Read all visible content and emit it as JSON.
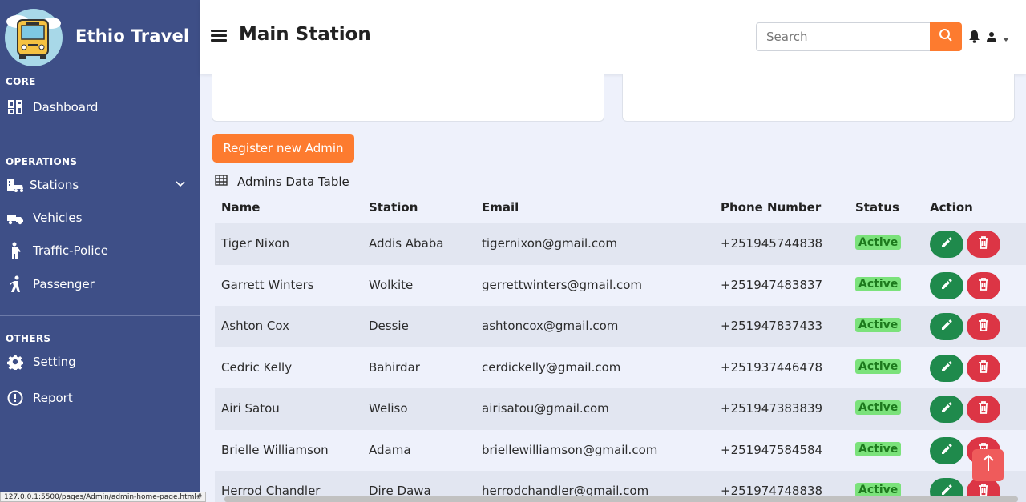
{
  "brand": {
    "name": "Ethio Travel"
  },
  "sidebar": {
    "sections": [
      "CORE",
      "OPERATIONS",
      "OTHERS"
    ],
    "items": [
      {
        "label": "Dashboard",
        "icon": "dashboard-icon"
      },
      {
        "label": "Stations",
        "icon": "station-icon"
      },
      {
        "label": "Vehicles",
        "icon": "vehicle-icon"
      },
      {
        "label": "Traffic-Police",
        "icon": "traffic-police-icon"
      },
      {
        "label": "Passenger",
        "icon": "passenger-icon"
      },
      {
        "label": "Setting",
        "icon": "gear-icon"
      },
      {
        "label": "Report",
        "icon": "alert-circle-icon"
      }
    ]
  },
  "header": {
    "title": "Main Station",
    "search_placeholder": "Search"
  },
  "actions": {
    "register_label": "Register new Admin"
  },
  "table": {
    "title": "Admins Data Table",
    "columns": [
      "Name",
      "Station",
      "Email",
      "Phone Number",
      "Status",
      "Action"
    ],
    "rows": [
      {
        "name": "Tiger Nixon",
        "station": "Addis Ababa",
        "email": "tigernixon@gmail.com",
        "phone": "+251945744838",
        "status": "Active"
      },
      {
        "name": "Garrett Winters",
        "station": "Wolkite",
        "email": "gerrettwinters@gmail.com",
        "phone": "+251947483837",
        "status": "Active"
      },
      {
        "name": "Ashton Cox",
        "station": "Dessie",
        "email": "ashtoncox@gmail.com",
        "phone": "+251947837433",
        "status": "Active"
      },
      {
        "name": "Cedric Kelly",
        "station": "Bahirdar",
        "email": "cerdickelly@gmail.com",
        "phone": "+251937446478",
        "status": "Active"
      },
      {
        "name": "Airi Satou",
        "station": "Weliso",
        "email": "airisatou@gmail.com",
        "phone": "+251947383839",
        "status": "Active"
      },
      {
        "name": "Brielle Williamson",
        "station": "Adama",
        "email": "briellewilliamson@gmail.com",
        "phone": "+251947584584",
        "status": "Active"
      },
      {
        "name": "Herrod Chandler",
        "station": "Dire Dawa",
        "email": "herrodchandler@gmail.com",
        "phone": "+251974748838",
        "status": "Active"
      }
    ]
  },
  "status_bar": {
    "url": "127.0.0.1:5500/pages/Admin/admin-home-page.html#"
  },
  "colors": {
    "sidebar": "#3e4f87",
    "accent": "#fd7b2f",
    "edit": "#1f8a4c",
    "delete": "#dc3545",
    "active_badge": "#7be27b"
  }
}
